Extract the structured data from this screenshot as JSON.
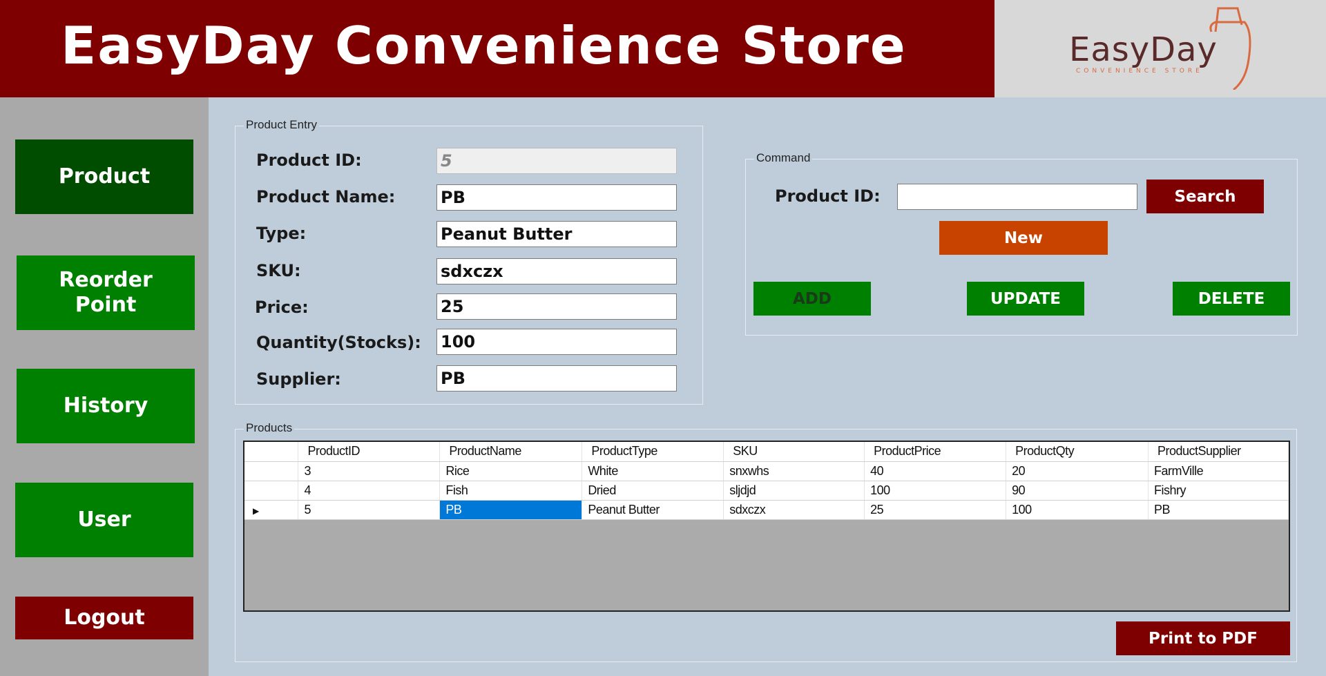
{
  "header": {
    "title": "EasyDay Convenience Store",
    "logo_text": "EasyDay",
    "logo_subtext": "CONVENIENCE STORE"
  },
  "sidebar": {
    "items": [
      {
        "label": "Product",
        "color": "#004d00"
      },
      {
        "label": "Reorder\nPoint",
        "color": "#008000"
      },
      {
        "label": "History",
        "color": "#008000"
      },
      {
        "label": "User",
        "color": "#008000"
      },
      {
        "label": "Logout",
        "color": "#7e0000"
      }
    ]
  },
  "product_entry": {
    "group_label": "Product Entry",
    "fields": [
      {
        "label": "Product ID:",
        "value": "5"
      },
      {
        "label": "Product Name:",
        "value": "PB"
      },
      {
        "label": "Type:",
        "value": "Peanut Butter"
      },
      {
        "label": "SKU:",
        "value": "sdxczx"
      },
      {
        "label": "Price:",
        "value": "25"
      },
      {
        "label": "Quantity(Stocks):",
        "value": "100"
      },
      {
        "label": "Supplier:",
        "value": "PB"
      }
    ]
  },
  "command": {
    "group_label": "Command",
    "search_label": "Product ID:",
    "search_value": "",
    "search_button": "Search",
    "new_button": "New",
    "add_button": "ADD",
    "update_button": "UPDATE",
    "delete_button": "DELETE"
  },
  "products": {
    "group_label": "Products",
    "columns": [
      "ProductID",
      "ProductName",
      "ProductType",
      "SKU",
      "ProductPrice",
      "ProductQty",
      "ProductSupplier"
    ],
    "rows": [
      [
        "3",
        "Rice",
        "White",
        "snxwhs",
        "40",
        "20",
        "FarmVille"
      ],
      [
        "4",
        "Fish",
        "Dried",
        "sljdjd",
        "100",
        "90",
        "Fishry"
      ],
      [
        "5",
        "PB",
        "Peanut Butter",
        "sdxczx",
        "25",
        "100",
        "PB"
      ]
    ],
    "current_row_marker": "▶"
  },
  "print_button": "Print to PDF",
  "colors": {
    "brand_red": "#7e0000",
    "brand_green": "#008000",
    "active_green": "#004d00",
    "new_orange": "#c84200",
    "selection_blue": "#0078d7"
  }
}
